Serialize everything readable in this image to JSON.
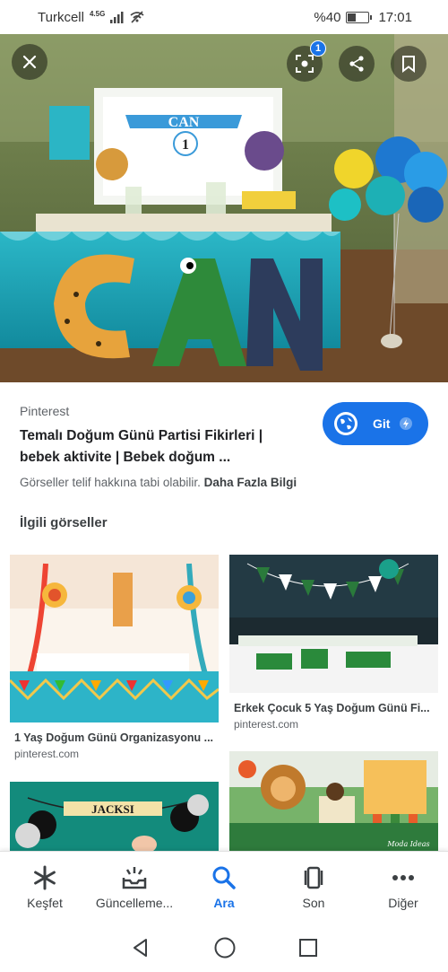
{
  "status": {
    "carrier": "Turkcell",
    "network": "4.5G",
    "battery_text": "%40",
    "battery_level": 0.4,
    "time": "17:01"
  },
  "hero": {
    "sign_name": "CAN",
    "sign_number": "1",
    "badge_count": "1"
  },
  "result": {
    "source": "Pinterest",
    "title_line1": "Temalı Doğum Günü Partisi Fikirleri |",
    "title_line2": "bebek aktivite | Bebek doğum ...",
    "visit_label": "Git",
    "copyright_text": "Görseller telif hakkına tabi olabilir.",
    "more_info_label": "Daha Fazla Bilgi"
  },
  "related": {
    "heading": "İlgili görseller",
    "items": [
      {
        "caption": "1 Yaş Doğum Günü Organizasyonu ...",
        "domain": "pinterest.com"
      },
      {
        "caption": "Erkek Çocuk 5 Yaş Doğum Günü Fi...",
        "domain": "pinterest.com"
      },
      {
        "banner_text": "JACKSI"
      },
      {
        "watermark": "Moda Ideas"
      }
    ]
  },
  "bottom_nav": {
    "items": [
      {
        "label": "Keşfet",
        "icon": "asterisk-icon"
      },
      {
        "label": "Güncelleme...",
        "icon": "updates-tray-icon"
      },
      {
        "label": "Ara",
        "icon": "search-icon",
        "active": true
      },
      {
        "label": "Son",
        "icon": "recent-tabs-icon"
      },
      {
        "label": "Diğer",
        "icon": "more-horizontal-icon"
      }
    ]
  },
  "colors": {
    "accent": "#1a73e8",
    "text_primary": "#202124",
    "text_secondary": "#5f6368"
  }
}
